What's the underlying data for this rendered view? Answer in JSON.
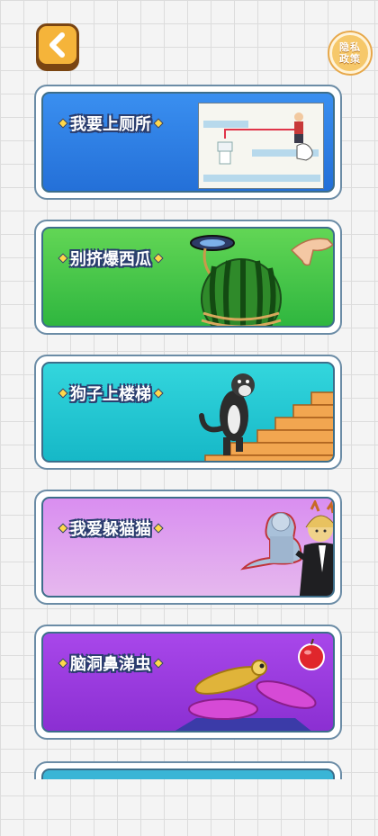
{
  "header": {
    "back_icon": "chevron-left-icon",
    "privacy_line1": "隐私",
    "privacy_line2": "政策"
  },
  "games": [
    {
      "title": "我要上厕所",
      "color": "#2f7ee8"
    },
    {
      "title": "别挤爆西瓜",
      "color": "#3fc24a"
    },
    {
      "title": "狗子上楼梯",
      "color": "#22c2cf"
    },
    {
      "title": "我爱躲猫猫",
      "color": "#d79be8"
    },
    {
      "title": "脑洞鼻涕虫",
      "color": "#9b3de0"
    }
  ],
  "colors": {
    "accent": "#f5b43a",
    "card_border": "#6b8ca6"
  }
}
